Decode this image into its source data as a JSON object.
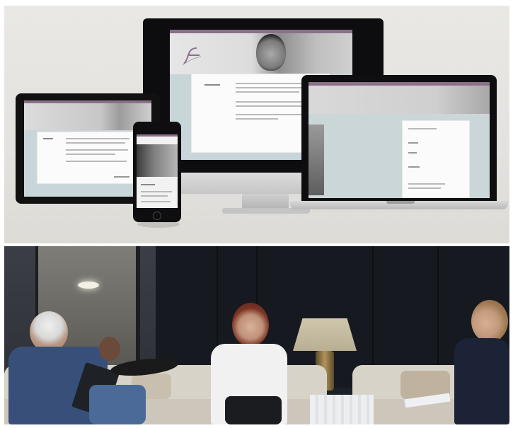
{
  "image": {
    "panels": [
      {
        "id": "device-mockups",
        "devices": [
          "desktop-monitor",
          "tablet",
          "smartphone",
          "laptop"
        ],
        "colors": {
          "background": "#e6e4e0",
          "bezel": "#0d0d0f",
          "site_accent": "#8b7089",
          "site_background": "#c9d6d9"
        }
      },
      {
        "id": "meeting-photo",
        "colors": {
          "wall": "#1c2027",
          "sofa": "#d8d3c9",
          "lamp_shade": "#cfc6ad"
        }
      }
    ]
  }
}
